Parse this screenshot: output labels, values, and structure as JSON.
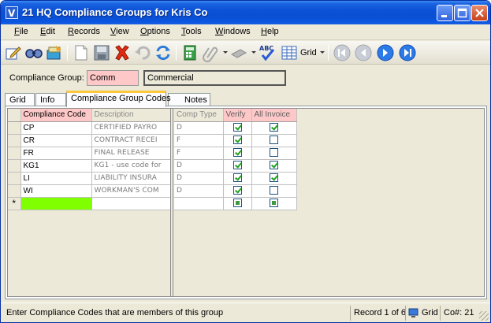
{
  "window": {
    "title": "21 HQ Compliance Groups for Kris Co"
  },
  "menu": {
    "items": [
      {
        "label": "File",
        "u": "F",
        "rest": "ile"
      },
      {
        "label": "Edit",
        "u": "E",
        "rest": "dit"
      },
      {
        "label": "Records",
        "u": "R",
        "rest": "ecords"
      },
      {
        "label": "View",
        "u": "V",
        "rest": "iew"
      },
      {
        "label": "Options",
        "u": "O",
        "rest": "ptions"
      },
      {
        "label": "Tools",
        "u": "T",
        "rest": "ools"
      },
      {
        "label": "Windows",
        "u": "W",
        "rest": "indows"
      },
      {
        "label": "Help",
        "u": "H",
        "rest": "elp"
      }
    ]
  },
  "toolbar": {
    "grid_label": "Grid",
    "icons": [
      "edit-icon",
      "find-icon",
      "refresh-data-icon",
      "new-record-icon",
      "save-icon",
      "delete-icon",
      "undo-icon",
      "refresh-icon",
      "calculator-icon",
      "attach-icon",
      "link-icon",
      "spell-check-icon",
      "grid-view-icon",
      "first-record-icon",
      "previous-record-icon",
      "next-record-icon",
      "last-record-icon"
    ]
  },
  "header": {
    "label": "Compliance Group:",
    "code_value": "Comm",
    "desc_value": "Commercial"
  },
  "tabs": [
    {
      "label": "Grid",
      "active": false
    },
    {
      "label": "Info",
      "active": false
    },
    {
      "label": "Compliance Group Codes",
      "active": true
    },
    {
      "label": "Notes",
      "active": false
    }
  ],
  "grid": {
    "left_headers": [
      "Compliance Code",
      "Description"
    ],
    "right_headers": [
      "Comp Type",
      "Verify",
      "All Invoice"
    ],
    "new_row_marker": "*",
    "rows": [
      {
        "code": "CP",
        "description": "CERTIFIED PAYRO",
        "comp_type": "D",
        "verify": true,
        "all_invoice": true
      },
      {
        "code": "CR",
        "description": "CONTRACT RECEI",
        "comp_type": "F",
        "verify": true,
        "all_invoice": false
      },
      {
        "code": "FR",
        "description": "FINAL RELEASE",
        "comp_type": "F",
        "verify": true,
        "all_invoice": false
      },
      {
        "code": "KG1",
        "description": "KG1 - use code for",
        "comp_type": "D",
        "verify": true,
        "all_invoice": true
      },
      {
        "code": "LI",
        "description": "LIABILITY INSURA",
        "comp_type": "D",
        "verify": true,
        "all_invoice": true
      },
      {
        "code": "WI",
        "description": "WORKMAN'S COM",
        "comp_type": "D",
        "verify": true,
        "all_invoice": false
      }
    ]
  },
  "status": {
    "message": "Enter Compliance Codes that are members of this group",
    "record": "Record 1 of 6",
    "view": "Grid",
    "company": "Co#: 21"
  },
  "colors": {
    "required_field": "#ffc8c8",
    "new_row": "#80ff00",
    "title_bar": "#0b52d8"
  }
}
